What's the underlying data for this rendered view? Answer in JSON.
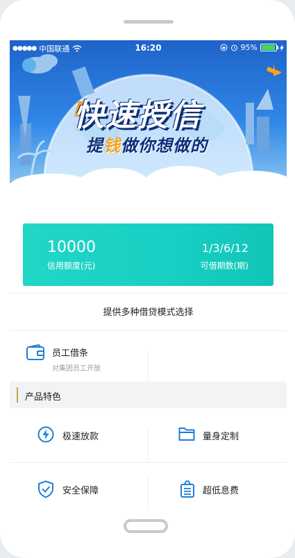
{
  "status_bar": {
    "signal_dots": "●●●●●",
    "carrier": "中国联通",
    "time": "16:20",
    "battery": "95%",
    "battery_level": 0.95
  },
  "banner": {
    "title": "快速授信",
    "subtitle_part1": "提",
    "subtitle_highlight": "钱",
    "subtitle_part2": "做你想做的"
  },
  "credit": {
    "amount": "10000",
    "amount_label": "信用额度(元)",
    "terms": "1/3/6/12",
    "terms_label": "可借期数(期)"
  },
  "modes_caption": "提供多种借贷模式选择",
  "loan_products": [
    {
      "title": "员工借条",
      "desc": "对集团员工开放",
      "icon": "wallet-icon"
    }
  ],
  "features_section": {
    "title": "产品特色",
    "items": [
      {
        "label": "极速放款",
        "icon": "lightning-icon"
      },
      {
        "label": "量身定制",
        "icon": "folder-icon"
      },
      {
        "label": "安全保障",
        "icon": "shield-check-icon"
      },
      {
        "label": "超低息费",
        "icon": "fee-bag-icon"
      }
    ]
  },
  "colors": {
    "accent_teal": "#1bd2c4",
    "banner_blue": "#2f87e6",
    "icon_blue": "#1e7fd8",
    "section_bar": "#c9a24e"
  }
}
